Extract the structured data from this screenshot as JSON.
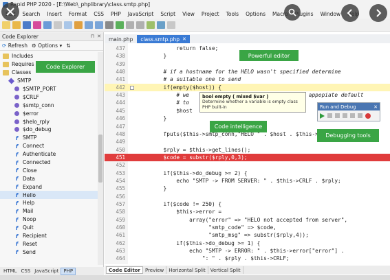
{
  "window": {
    "title": "Rapid PHP 2020 - [E:\\Web\\_phplibrary\\class.smtp.php]"
  },
  "menu": [
    "Edit",
    "Search",
    "Insert",
    "Format",
    "CSS",
    "PHP",
    "JavaScript",
    "Script",
    "View",
    "Project",
    "Tools",
    "Options",
    "Macro",
    "Plugins",
    "Window",
    "Help"
  ],
  "overlay_controls": [
    "close-icon",
    "search-icon",
    "chevron-left-icon",
    "chevron-right-icon"
  ],
  "left_panel": {
    "title": "Code Explorer",
    "refresh_label": "Refresh",
    "options_label": "Options",
    "tree": [
      {
        "label": "Includes",
        "kind": "folder",
        "indent": 0
      },
      {
        "label": "Requires",
        "kind": "folder",
        "indent": 0
      },
      {
        "label": "Classes",
        "kind": "folder",
        "indent": 0
      },
      {
        "label": "SMTP",
        "kind": "class",
        "indent": 1
      },
      {
        "label": "$SMTP_PORT",
        "kind": "var",
        "indent": 2
      },
      {
        "label": "$CRLF",
        "kind": "var",
        "indent": 2
      },
      {
        "label": "$smtp_conn",
        "kind": "var",
        "indent": 2
      },
      {
        "label": "$error",
        "kind": "var",
        "indent": 2
      },
      {
        "label": "$helo_rply",
        "kind": "var",
        "indent": 2
      },
      {
        "label": "$do_debug",
        "kind": "var",
        "indent": 2
      },
      {
        "label": "SMTP",
        "kind": "fn",
        "indent": 2
      },
      {
        "label": "Connect",
        "kind": "fn",
        "indent": 2
      },
      {
        "label": "Authenticate",
        "kind": "fn",
        "indent": 2
      },
      {
        "label": "Connected",
        "kind": "fn",
        "indent": 2
      },
      {
        "label": "Close",
        "kind": "fn",
        "indent": 2
      },
      {
        "label": "Data",
        "kind": "fn",
        "indent": 2
      },
      {
        "label": "Expand",
        "kind": "fn",
        "indent": 2
      },
      {
        "label": "Hello",
        "kind": "fn",
        "indent": 2,
        "selected": true
      },
      {
        "label": "Help",
        "kind": "fn",
        "indent": 2
      },
      {
        "label": "Mail",
        "kind": "fn",
        "indent": 2
      },
      {
        "label": "Noop",
        "kind": "fn",
        "indent": 2
      },
      {
        "label": "Quit",
        "kind": "fn",
        "indent": 2
      },
      {
        "label": "Recipient",
        "kind": "fn",
        "indent": 2
      },
      {
        "label": "Reset",
        "kind": "fn",
        "indent": 2
      },
      {
        "label": "Send",
        "kind": "fn",
        "indent": 2
      }
    ],
    "bottom_tabs": [
      "HTML",
      "CSS",
      "JavaScript",
      "PHP"
    ],
    "active_bottom_tab": "PHP"
  },
  "editor": {
    "tabs": [
      {
        "label": "main.php",
        "active": false
      },
      {
        "label": "class.smtp.php",
        "active": true
      }
    ],
    "lines": [
      {
        "n": "437",
        "code": "            return false;"
      },
      {
        "n": "438",
        "code": "        }"
      },
      {
        "n": "439",
        "code": ""
      },
      {
        "n": "440",
        "code": "        # if a hostname for the HELO wasn't specified determine"
      },
      {
        "n": "441",
        "code": "        # a suitable one to send"
      },
      {
        "n": "442",
        "code": "        if(empty($host)) {",
        "current": true
      },
      {
        "n": "443",
        "code": "            # we                                  of appopiate default"
      },
      {
        "n": "444",
        "code": "            # to"
      },
      {
        "n": "445",
        "code": "            $host"
      },
      {
        "n": "446",
        "code": "        }"
      },
      {
        "n": "447",
        "code": ""
      },
      {
        "n": "448",
        "code": "        fputs($this->smtp_conn,\"HELO \" . $host . $this->CRLF);"
      },
      {
        "n": "449",
        "code": ""
      },
      {
        "n": "450",
        "code": "        $rply = $this->get_lines();"
      },
      {
        "n": "451",
        "code": "        $code = substr($rply,0,3);",
        "error": true
      },
      {
        "n": "452",
        "code": ""
      },
      {
        "n": "453",
        "code": "        if($this->do_debug >= 2) {"
      },
      {
        "n": "454",
        "code": "            echo \"SMTP -> FROM SERVER: \" . $this->CRLF . $rply;"
      },
      {
        "n": "455",
        "code": "        }"
      },
      {
        "n": "456",
        "code": ""
      },
      {
        "n": "457",
        "code": "        if($code != 250) {"
      },
      {
        "n": "458",
        "code": "            $this->error ="
      },
      {
        "n": "459",
        "code": "                array(\"error\" => \"HELO not accepted from server\","
      },
      {
        "n": "460",
        "code": "                      \"smtp_code\" => $code,"
      },
      {
        "n": "461",
        "code": "                      \"smtp_msg\" => substr($rply,4));"
      },
      {
        "n": "462",
        "code": "            if($this->do_debug >= 1) {"
      },
      {
        "n": "463",
        "code": "                echo \"SMTP -> ERROR: \" . $this->error[\"error\"] ."
      },
      {
        "n": "464",
        "code": "                    \": \" . $rply . $this->CRLF;"
      }
    ],
    "tooltip": {
      "signature": "bool empty ( mixed $var )",
      "description": "Determine whether a variable is empty class PHP built-in"
    },
    "bottom_tabs": [
      "Code Editor",
      "Preview",
      "Horizontal Split",
      "Vertical Split"
    ],
    "active_bottom_tab": "Code Editor"
  },
  "run_debug": {
    "title": "Run and Debug"
  },
  "callouts": {
    "code_explorer": "Code Explorer",
    "powerful_editor": "Powerful editor",
    "code_intelligence": "Code intelligence",
    "debugging_tools": "Debugging tools"
  },
  "colors": {
    "callout": "#3aa545",
    "active_tab": "#3a7bd5",
    "error_line": "#e03c3c",
    "current_line": "#fff5b5"
  }
}
